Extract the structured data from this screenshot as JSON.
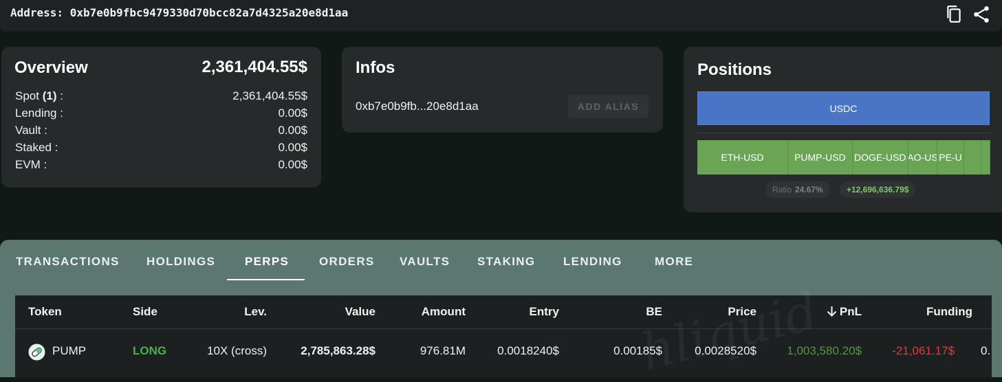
{
  "header": {
    "address_label": "Address:",
    "address": "0xb7e0b9fbc9479330d70bcc82a7d4325a20e8d1aa",
    "icons": [
      "copy-icon",
      "share-icon"
    ]
  },
  "overview": {
    "title": "Overview",
    "total": "2,361,404.55$",
    "rows": [
      {
        "label": "Spot",
        "count": "(1)",
        "suffix": " :",
        "value": "2,361,404.55$"
      },
      {
        "label": "Lending :",
        "value": "0.00$"
      },
      {
        "label": "Vault :",
        "value": "0.00$"
      },
      {
        "label": "Staked :",
        "value": "0.00$"
      },
      {
        "label": "EVM :",
        "value": "0.00$"
      }
    ]
  },
  "infos": {
    "title": "Infos",
    "short_address": "0xb7e0b9fb...20e8d1aa",
    "add_alias_label": "ADD ALIAS"
  },
  "positions": {
    "title": "Positions",
    "spot_bar_label": "USDC",
    "perp_segments": [
      {
        "label": "ETH-USD",
        "share": 0.31
      },
      {
        "label": "PUMP-USD",
        "share": 0.22
      },
      {
        "label": "DOGE-USD",
        "share": 0.19
      },
      {
        "label": "AO-US",
        "share": 0.1
      },
      {
        "label": "PE-U",
        "share": 0.09
      },
      {
        "label": "",
        "share": 0.06
      },
      {
        "label": "",
        "share": 0.03
      }
    ],
    "ratio_label": "Ratio",
    "ratio_value": "24.67%",
    "pnl_value": "+12,696,636.79$"
  },
  "tabs": {
    "items": [
      "TRANSACTIONS",
      "HOLDINGS",
      "PERPS",
      "ORDERS",
      "VAULTS",
      "STAKING",
      "LENDING",
      "MORE"
    ],
    "active": "PERPS"
  },
  "table": {
    "headers": {
      "token": "Token",
      "side": "Side",
      "lev": "Lev.",
      "value": "Value",
      "amount": "Amount",
      "entry": "Entry",
      "be": "BE",
      "price": "Price",
      "pnl": "PnL",
      "funding": "Funding"
    },
    "rows": [
      {
        "token": "PUMP",
        "side": "LONG",
        "lev": "10X (cross)",
        "value": "2,785,863.28$",
        "amount": "976.81M",
        "entry": "0.0018240$",
        "be": "0.00185$",
        "price": "0.0028520$",
        "pnl": "1,003,580.20$",
        "funding": "-21,061.17$",
        "extra": "0."
      }
    ]
  },
  "watermark": "hliquid",
  "colors": {
    "accent_blue": "#4a74c6",
    "positive": "#6aa555",
    "negative": "#e53935",
    "long": "#4caf50"
  }
}
